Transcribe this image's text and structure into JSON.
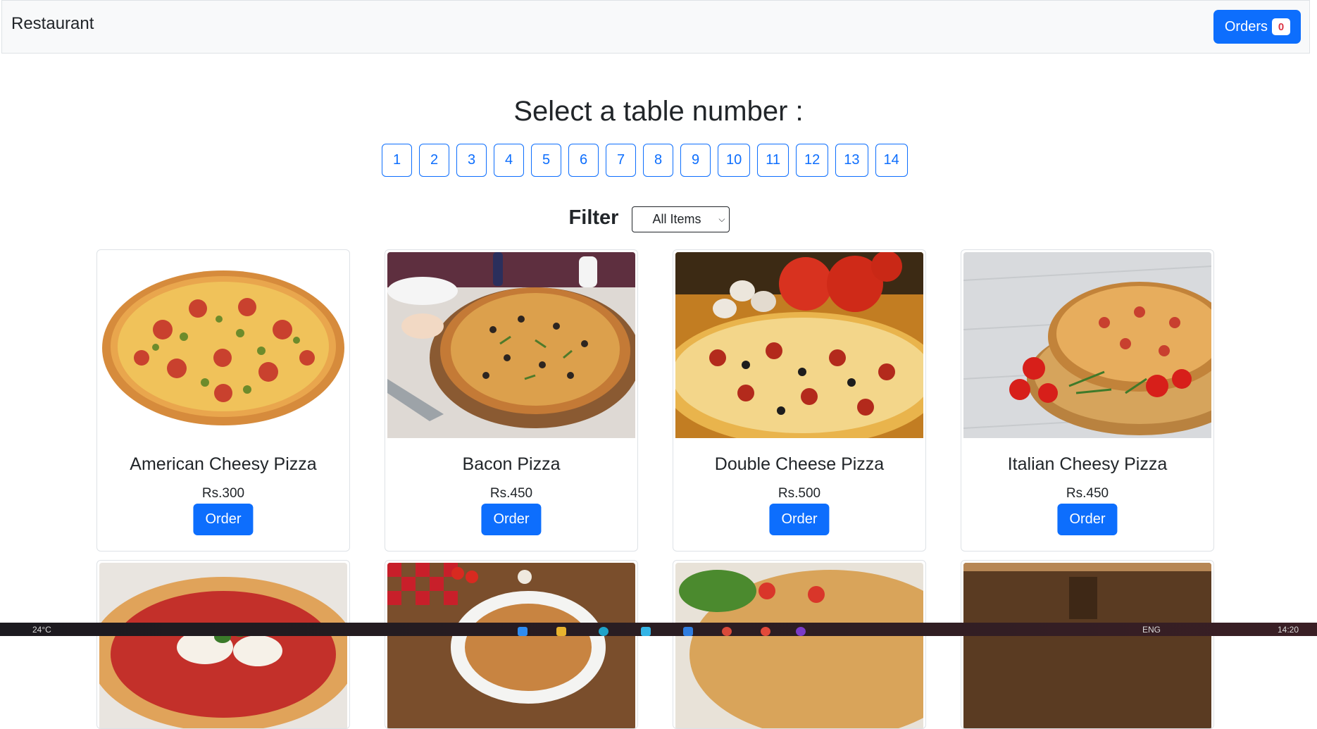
{
  "navbar": {
    "brand": "Restaurant",
    "orders_label": "Orders",
    "orders_count": "0"
  },
  "heading": "Select a table number :",
  "tables": [
    "1",
    "2",
    "3",
    "4",
    "5",
    "6",
    "7",
    "8",
    "9",
    "10",
    "11",
    "12",
    "13",
    "14"
  ],
  "filter": {
    "label": "Filter",
    "selected": "All Items"
  },
  "order_label": "Order",
  "items": [
    {
      "name": "American Cheesy Pizza",
      "price": "Rs.300"
    },
    {
      "name": "Bacon Pizza",
      "price": "Rs.450"
    },
    {
      "name": "Double Cheese Pizza",
      "price": "Rs.500"
    },
    {
      "name": "Italian Cheesy Pizza",
      "price": "Rs.450"
    }
  ],
  "taskbar": {
    "weather": "24°C",
    "lang": "ENG",
    "time": "14:20"
  },
  "colors": {
    "primary": "#0d6efd",
    "badge_text": "#dc3545"
  }
}
